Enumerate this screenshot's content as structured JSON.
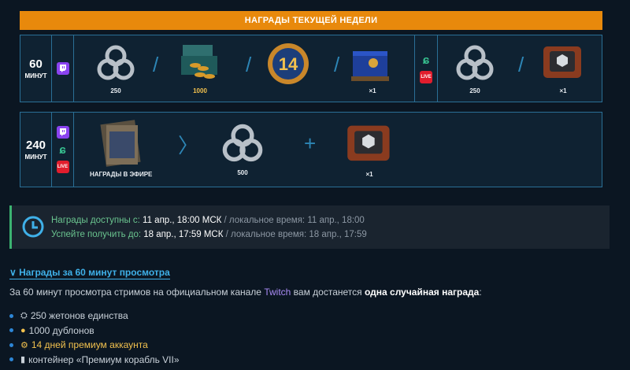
{
  "banner": {
    "title": "НАГРАДЫ ТЕКУЩЕЙ НЕДЕЛИ"
  },
  "panel1": {
    "time_value": "60",
    "time_unit": "МИНУТ",
    "items": [
      {
        "label": "250"
      },
      {
        "label": "1000"
      },
      {
        "label": ""
      },
      {
        "label": "×1"
      },
      {
        "label": "250"
      },
      {
        "label": "×1"
      }
    ],
    "live_badge": "LIVE"
  },
  "panel2": {
    "time_value": "240",
    "time_unit": "МИНУТ",
    "live_badge": "LIVE",
    "items": [
      {
        "label": "НАГРАДЫ В ЭФИРЕ"
      },
      {
        "label": "500"
      },
      {
        "label": "×1"
      }
    ]
  },
  "availability": {
    "line1_label": "Награды доступны с:",
    "line1_value": "11 апр., 18:00 МСК",
    "line1_local": "/ локальное время: 11 апр., 18:00",
    "line2_label": "Успейте получить до:",
    "line2_value": "18 апр., 17:59 МСК",
    "line2_local": "/ локальное время: 18 апр., 17:59"
  },
  "section": {
    "title": "∨ Награды за 60 минут просмотра",
    "para_before": "За 60 минут просмотра стримов на официальном канале ",
    "para_link": "Twitch",
    "para_middle": " вам достанется ",
    "para_bold": "одна случайная награда",
    "para_after": ":",
    "rewards": [
      {
        "icon": "⛭",
        "text": "250 жетонов единства"
      },
      {
        "icon": "●",
        "text": "1000 дублонов"
      },
      {
        "icon": "⚙",
        "text": "14 дней премиум аккаунта"
      },
      {
        "icon": "▮",
        "text": "контейнер «Премиум корабль VII»"
      }
    ]
  },
  "colors": {
    "accent": "#e8890c",
    "border": "#2a6f96",
    "twitch": "#8a43f0",
    "live": "#e11d2d",
    "green": "#3cb371"
  }
}
